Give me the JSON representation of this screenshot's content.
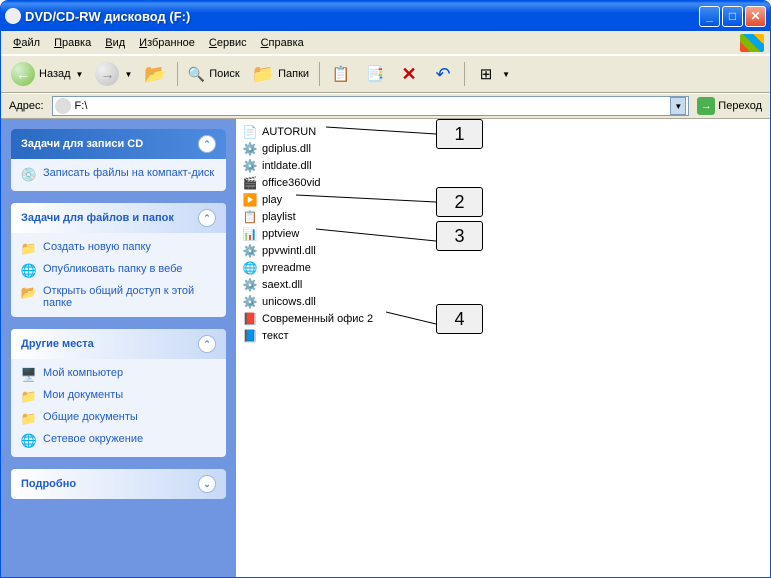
{
  "title": "DVD/CD-RW дисковод (F:)",
  "menu": [
    "Файл",
    "Правка",
    "Вид",
    "Избранное",
    "Сервис",
    "Справка"
  ],
  "tb": {
    "back": "Назад",
    "search": "Поиск",
    "folders": "Папки"
  },
  "addr": {
    "label": "Адрес:",
    "value": "F:\\",
    "go": "Переход"
  },
  "panels": {
    "cd": {
      "title": "Задачи для записи CD",
      "links": [
        {
          "icon": "💿",
          "text": "Записать файлы на компакт-диск"
        }
      ]
    },
    "ff": {
      "title": "Задачи для файлов и папок",
      "links": [
        {
          "icon": "📁",
          "text": "Создать новую папку"
        },
        {
          "icon": "🌐",
          "text": "Опубликовать папку в вебе"
        },
        {
          "icon": "📂",
          "text": "Открыть общий доступ к этой папке"
        }
      ]
    },
    "pl": {
      "title": "Другие места",
      "links": [
        {
          "icon": "🖥️",
          "text": "Мой компьютер"
        },
        {
          "icon": "📁",
          "text": "Мои документы"
        },
        {
          "icon": "📁",
          "text": "Общие документы"
        },
        {
          "icon": "🌐",
          "text": "Сетевое окружение"
        }
      ]
    },
    "det": {
      "title": "Подробно"
    }
  },
  "files": [
    {
      "icon": "📄",
      "name": "AUTORUN"
    },
    {
      "icon": "⚙️",
      "name": "gdiplus.dll"
    },
    {
      "icon": "⚙️",
      "name": "intldate.dll"
    },
    {
      "icon": "🎬",
      "name": "office360vid"
    },
    {
      "icon": "▶️",
      "name": "play"
    },
    {
      "icon": "📋",
      "name": "playlist"
    },
    {
      "icon": "📊",
      "name": "pptview"
    },
    {
      "icon": "⚙️",
      "name": "ppvwintl.dll"
    },
    {
      "icon": "🌐",
      "name": "pvreadme"
    },
    {
      "icon": "⚙️",
      "name": "saext.dll"
    },
    {
      "icon": "⚙️",
      "name": "unicows.dll"
    },
    {
      "icon": "📕",
      "name": "Современный офис 2"
    },
    {
      "icon": "📘",
      "name": "текст"
    }
  ],
  "callouts": [
    "1",
    "2",
    "3",
    "4"
  ]
}
